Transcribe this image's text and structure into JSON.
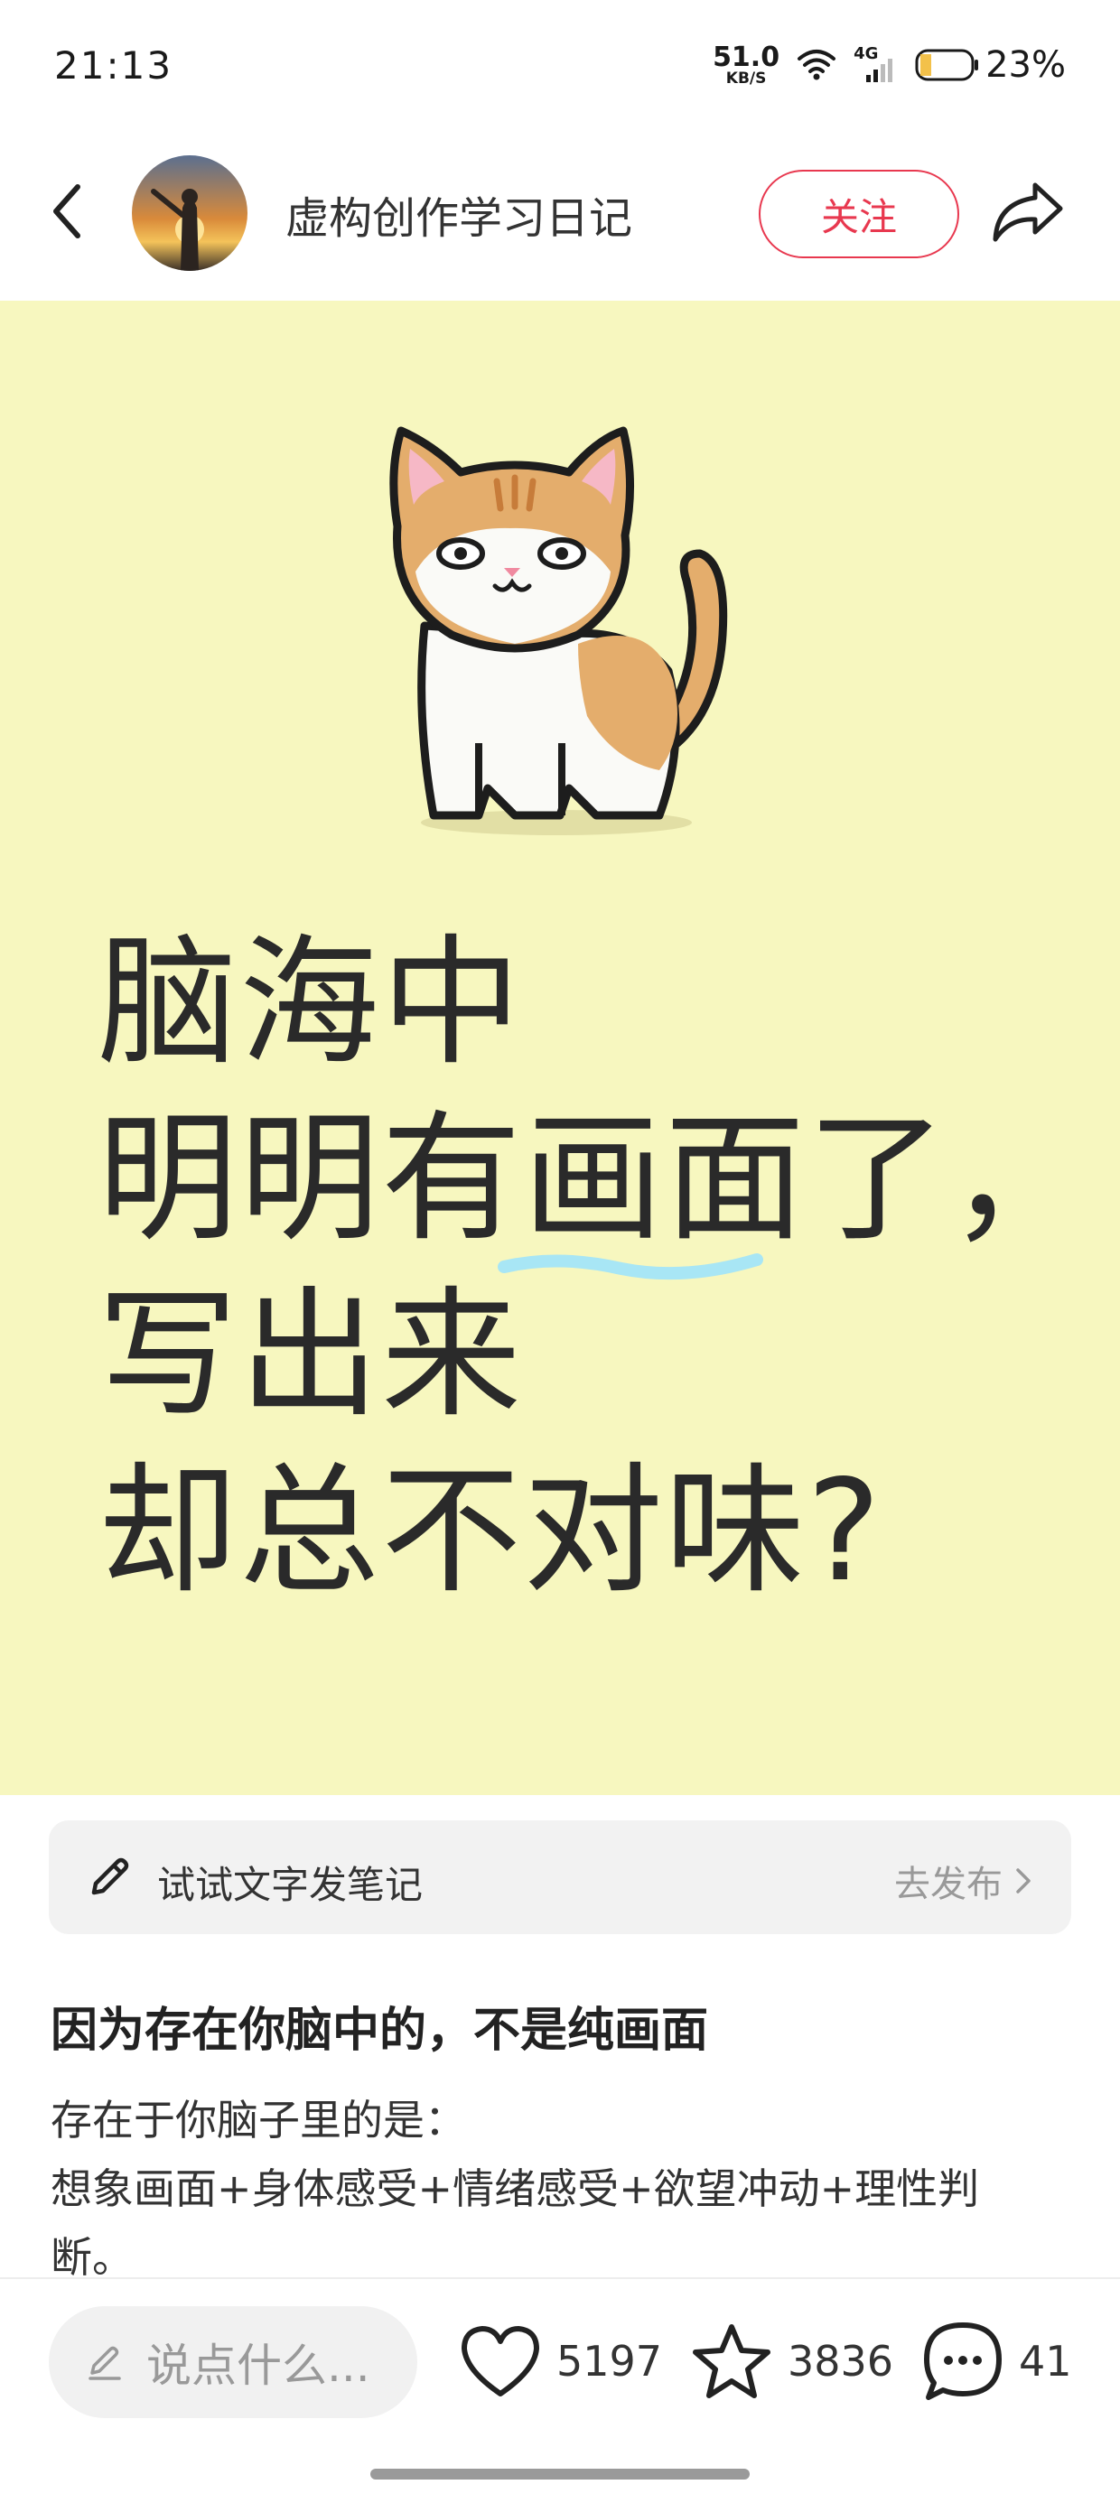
{
  "status_bar": {
    "time": "21:13",
    "net_speed": "51.0",
    "net_unit": "KB/S",
    "network_type": "4G",
    "battery_percent": "23%",
    "battery_level": 0.23,
    "icons": [
      "wifi-icon",
      "signal-icon",
      "battery-icon"
    ]
  },
  "header": {
    "author_name": "虚构创作学习日记",
    "follow_label": "关注",
    "icons": [
      "back-arrow-icon",
      "share-icon"
    ],
    "accent_color": "#e8384f"
  },
  "hero": {
    "background_color": "#f7f7bf",
    "lines": [
      "脑海中",
      "明明有画面了，",
      "写出来",
      "却总不对味?"
    ],
    "highlight_color": "#a8e6f5",
    "image_subject": "cat-illustration"
  },
  "try_bar": {
    "label": "试试文字发笔记",
    "action": "去发布",
    "icons": [
      "pencil-icon",
      "chevron-right-icon"
    ]
  },
  "note": {
    "title": "因为存在你脑中的，不是纯画面",
    "body_lines": [
      "存在于你脑子里的是：",
      "想象画面+身体感受+情绪感受+欲望冲动+理性判",
      "断。"
    ]
  },
  "bottom_bar": {
    "comment_placeholder": "说点什么...",
    "like_count": "5197",
    "favorite_count": "3836",
    "comment_count": "41",
    "icons": [
      "edit-icon",
      "heart-icon",
      "star-icon",
      "comment-icon"
    ]
  }
}
